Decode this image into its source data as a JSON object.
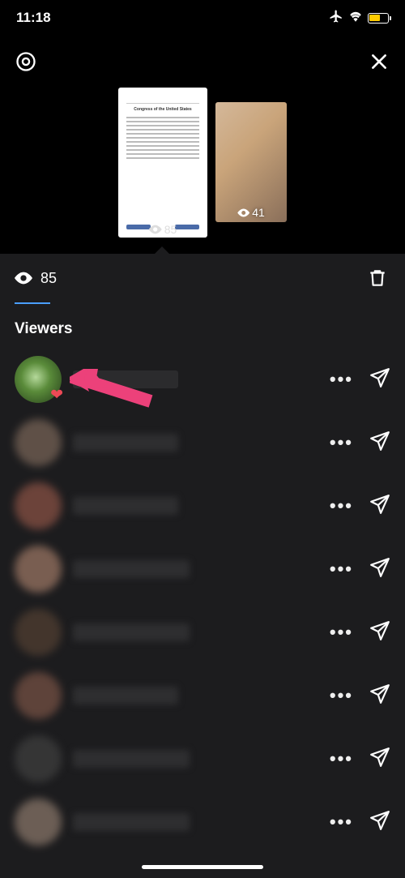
{
  "status": {
    "time": "11:18"
  },
  "stories": {
    "thumb1_count": "85",
    "thumb2_count": "41"
  },
  "panel": {
    "view_count": "85",
    "section_title": "Viewers"
  }
}
